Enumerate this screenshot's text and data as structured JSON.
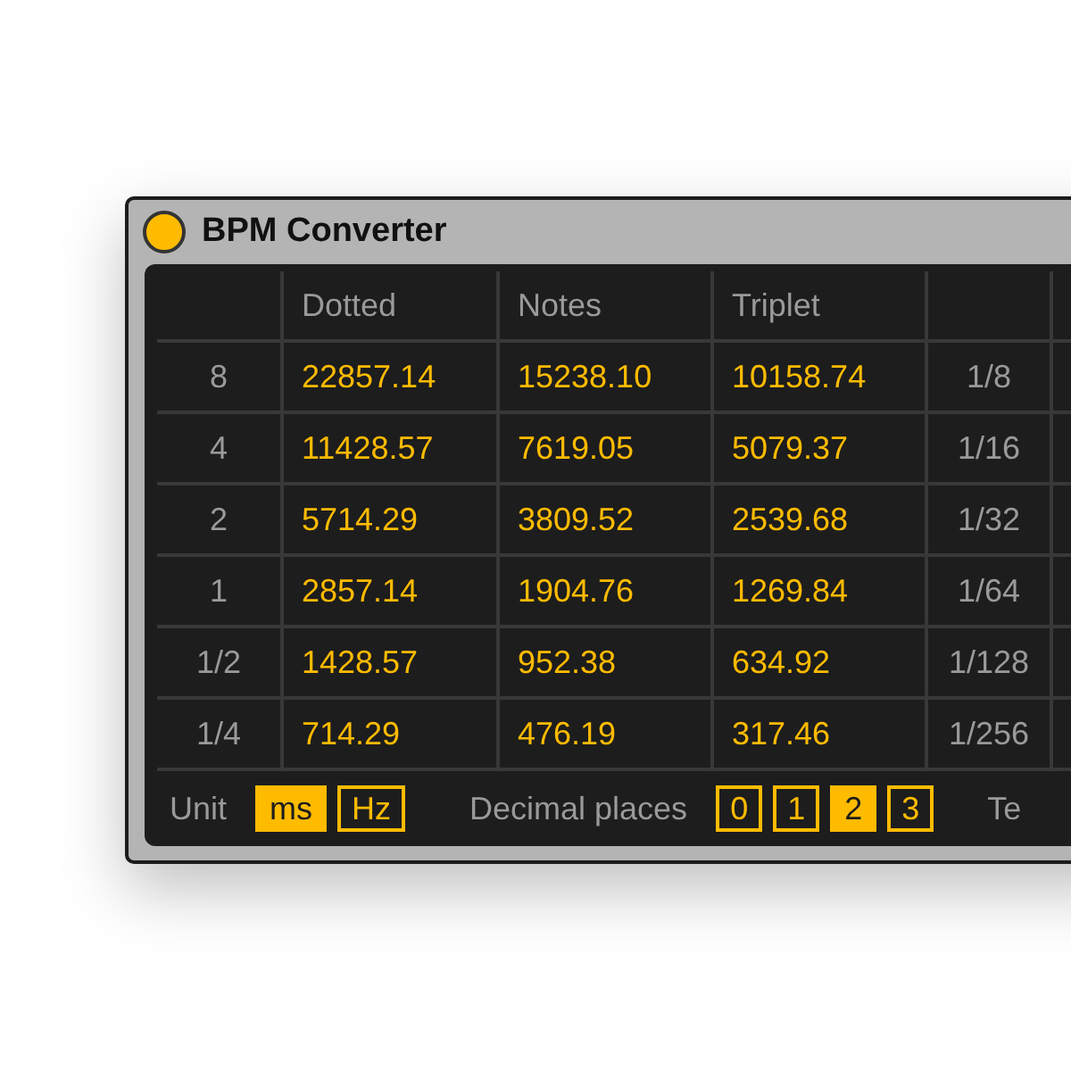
{
  "window": {
    "title": "BPM Converter"
  },
  "table": {
    "columns": [
      "Dotted",
      "Notes",
      "Triplet"
    ],
    "rows": [
      {
        "multiple": "8",
        "dotted": "22857.14",
        "notes": "15238.10",
        "triplet": "10158.74",
        "division": "1/8"
      },
      {
        "multiple": "4",
        "dotted": "11428.57",
        "notes": "7619.05",
        "triplet": "5079.37",
        "division": "1/16"
      },
      {
        "multiple": "2",
        "dotted": "5714.29",
        "notes": "3809.52",
        "triplet": "2539.68",
        "division": "1/32"
      },
      {
        "multiple": "1",
        "dotted": "2857.14",
        "notes": "1904.76",
        "triplet": "1269.84",
        "division": "1/64"
      },
      {
        "multiple": "1/2",
        "dotted": "1428.57",
        "notes": "952.38",
        "triplet": "634.92",
        "division": "1/128"
      },
      {
        "multiple": "1/4",
        "dotted": "714.29",
        "notes": "476.19",
        "triplet": "317.46",
        "division": "1/256"
      }
    ]
  },
  "footer": {
    "unit_label": "Unit",
    "units": [
      {
        "label": "ms",
        "selected": true
      },
      {
        "label": "Hz",
        "selected": false
      }
    ],
    "decimal_label": "Decimal places",
    "decimals": [
      {
        "label": "0",
        "selected": false
      },
      {
        "label": "1",
        "selected": false
      },
      {
        "label": "2",
        "selected": true
      },
      {
        "label": "3",
        "selected": false
      }
    ],
    "cut_label": "Te"
  }
}
